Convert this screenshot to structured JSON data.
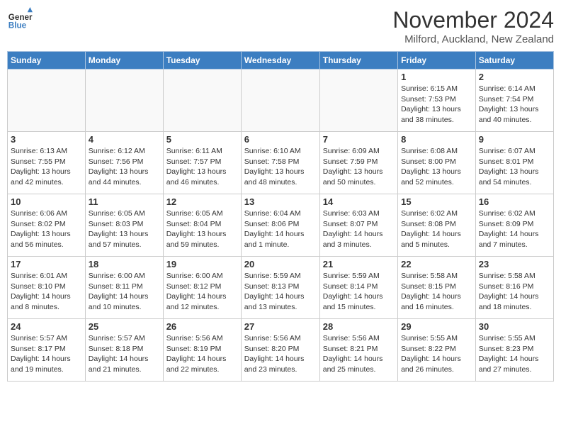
{
  "header": {
    "logo_line1": "General",
    "logo_line2": "Blue",
    "month_title": "November 2024",
    "location": "Milford, Auckland, New Zealand"
  },
  "days_of_week": [
    "Sunday",
    "Monday",
    "Tuesday",
    "Wednesday",
    "Thursday",
    "Friday",
    "Saturday"
  ],
  "weeks": [
    [
      {
        "day": "",
        "info": ""
      },
      {
        "day": "",
        "info": ""
      },
      {
        "day": "",
        "info": ""
      },
      {
        "day": "",
        "info": ""
      },
      {
        "day": "",
        "info": ""
      },
      {
        "day": "1",
        "info": "Sunrise: 6:15 AM\nSunset: 7:53 PM\nDaylight: 13 hours\nand 38 minutes."
      },
      {
        "day": "2",
        "info": "Sunrise: 6:14 AM\nSunset: 7:54 PM\nDaylight: 13 hours\nand 40 minutes."
      }
    ],
    [
      {
        "day": "3",
        "info": "Sunrise: 6:13 AM\nSunset: 7:55 PM\nDaylight: 13 hours\nand 42 minutes."
      },
      {
        "day": "4",
        "info": "Sunrise: 6:12 AM\nSunset: 7:56 PM\nDaylight: 13 hours\nand 44 minutes."
      },
      {
        "day": "5",
        "info": "Sunrise: 6:11 AM\nSunset: 7:57 PM\nDaylight: 13 hours\nand 46 minutes."
      },
      {
        "day": "6",
        "info": "Sunrise: 6:10 AM\nSunset: 7:58 PM\nDaylight: 13 hours\nand 48 minutes."
      },
      {
        "day": "7",
        "info": "Sunrise: 6:09 AM\nSunset: 7:59 PM\nDaylight: 13 hours\nand 50 minutes."
      },
      {
        "day": "8",
        "info": "Sunrise: 6:08 AM\nSunset: 8:00 PM\nDaylight: 13 hours\nand 52 minutes."
      },
      {
        "day": "9",
        "info": "Sunrise: 6:07 AM\nSunset: 8:01 PM\nDaylight: 13 hours\nand 54 minutes."
      }
    ],
    [
      {
        "day": "10",
        "info": "Sunrise: 6:06 AM\nSunset: 8:02 PM\nDaylight: 13 hours\nand 56 minutes."
      },
      {
        "day": "11",
        "info": "Sunrise: 6:05 AM\nSunset: 8:03 PM\nDaylight: 13 hours\nand 57 minutes."
      },
      {
        "day": "12",
        "info": "Sunrise: 6:05 AM\nSunset: 8:04 PM\nDaylight: 13 hours\nand 59 minutes."
      },
      {
        "day": "13",
        "info": "Sunrise: 6:04 AM\nSunset: 8:06 PM\nDaylight: 14 hours\nand 1 minute."
      },
      {
        "day": "14",
        "info": "Sunrise: 6:03 AM\nSunset: 8:07 PM\nDaylight: 14 hours\nand 3 minutes."
      },
      {
        "day": "15",
        "info": "Sunrise: 6:02 AM\nSunset: 8:08 PM\nDaylight: 14 hours\nand 5 minutes."
      },
      {
        "day": "16",
        "info": "Sunrise: 6:02 AM\nSunset: 8:09 PM\nDaylight: 14 hours\nand 7 minutes."
      }
    ],
    [
      {
        "day": "17",
        "info": "Sunrise: 6:01 AM\nSunset: 8:10 PM\nDaylight: 14 hours\nand 8 minutes."
      },
      {
        "day": "18",
        "info": "Sunrise: 6:00 AM\nSunset: 8:11 PM\nDaylight: 14 hours\nand 10 minutes."
      },
      {
        "day": "19",
        "info": "Sunrise: 6:00 AM\nSunset: 8:12 PM\nDaylight: 14 hours\nand 12 minutes."
      },
      {
        "day": "20",
        "info": "Sunrise: 5:59 AM\nSunset: 8:13 PM\nDaylight: 14 hours\nand 13 minutes."
      },
      {
        "day": "21",
        "info": "Sunrise: 5:59 AM\nSunset: 8:14 PM\nDaylight: 14 hours\nand 15 minutes."
      },
      {
        "day": "22",
        "info": "Sunrise: 5:58 AM\nSunset: 8:15 PM\nDaylight: 14 hours\nand 16 minutes."
      },
      {
        "day": "23",
        "info": "Sunrise: 5:58 AM\nSunset: 8:16 PM\nDaylight: 14 hours\nand 18 minutes."
      }
    ],
    [
      {
        "day": "24",
        "info": "Sunrise: 5:57 AM\nSunset: 8:17 PM\nDaylight: 14 hours\nand 19 minutes."
      },
      {
        "day": "25",
        "info": "Sunrise: 5:57 AM\nSunset: 8:18 PM\nDaylight: 14 hours\nand 21 minutes."
      },
      {
        "day": "26",
        "info": "Sunrise: 5:56 AM\nSunset: 8:19 PM\nDaylight: 14 hours\nand 22 minutes."
      },
      {
        "day": "27",
        "info": "Sunrise: 5:56 AM\nSunset: 8:20 PM\nDaylight: 14 hours\nand 23 minutes."
      },
      {
        "day": "28",
        "info": "Sunrise: 5:56 AM\nSunset: 8:21 PM\nDaylight: 14 hours\nand 25 minutes."
      },
      {
        "day": "29",
        "info": "Sunrise: 5:55 AM\nSunset: 8:22 PM\nDaylight: 14 hours\nand 26 minutes."
      },
      {
        "day": "30",
        "info": "Sunrise: 5:55 AM\nSunset: 8:23 PM\nDaylight: 14 hours\nand 27 minutes."
      }
    ]
  ]
}
